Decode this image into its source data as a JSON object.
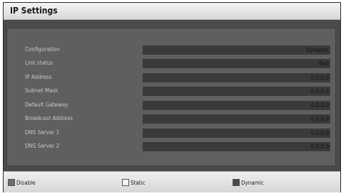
{
  "window": {
    "title": "IP Settings"
  },
  "settings": [
    {
      "label": "Configuration",
      "value": "Dynamic"
    },
    {
      "label": "Link status",
      "value": "Bad"
    },
    {
      "label": "IP Address",
      "value": "0.0.0.0"
    },
    {
      "label": "Subnet Mask",
      "value": "0.0.0.0"
    },
    {
      "label": "Default Gateway",
      "value": "0.0.0.0"
    },
    {
      "label": "Broadcast Address",
      "value": "0.0.0.0"
    },
    {
      "label": "DNS Server 1",
      "value": "0.0.0.0"
    },
    {
      "label": "DNS Server 2",
      "value": "0.0.0.0"
    }
  ],
  "options": [
    {
      "label": "Disable",
      "color": "#6d6d6d"
    },
    {
      "label": "Static",
      "color": "#f2f2f2"
    },
    {
      "label": "Dynamic",
      "color": "#4a4a4a"
    }
  ]
}
